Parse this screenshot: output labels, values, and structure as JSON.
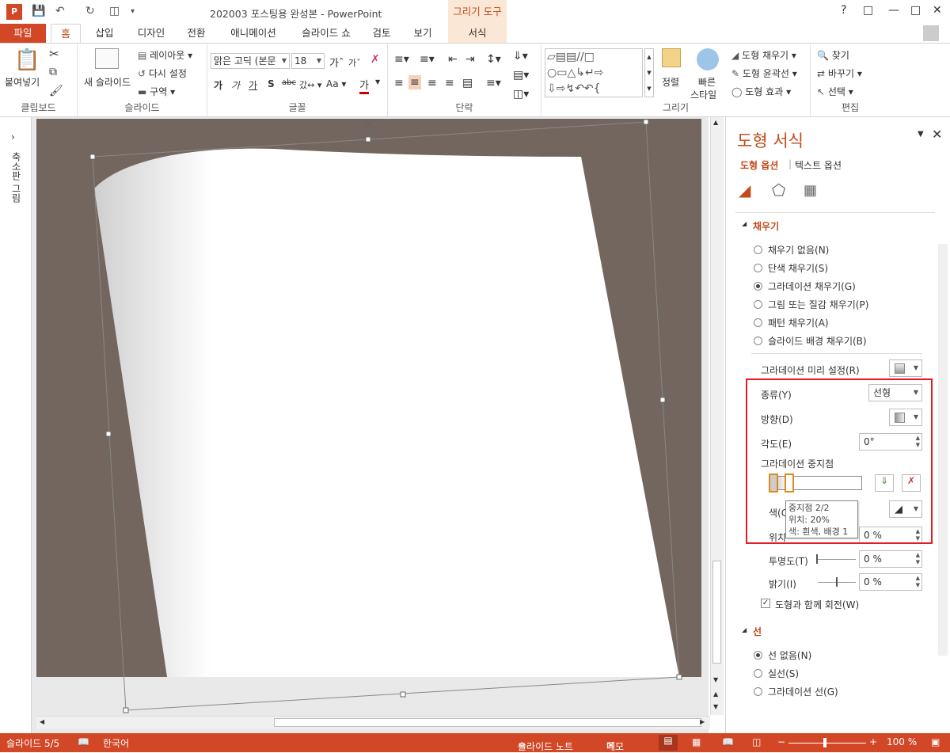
{
  "titlebar": {
    "title": "202003 포스팅용 완성본 - PowerPoint",
    "drawing_tools": "그리기 도구"
  },
  "tabs": [
    "파일",
    "홈",
    "삽입",
    "디자인",
    "전환",
    "애니메이션",
    "슬라이드 쇼",
    "검토",
    "보기",
    "서식"
  ],
  "ribbon": {
    "clipboard": {
      "paste": "붙여넣기",
      "label": "클립보드"
    },
    "slides": {
      "new_slide": "새 슬라이드",
      "layout": "레이아웃",
      "reset": "다시 설정",
      "section": "구역",
      "label": "슬라이드"
    },
    "font": {
      "font_name": "맑은 고딕 (본문",
      "font_size": "18",
      "label": "글꼴"
    },
    "paragraph": {
      "label": "단락"
    },
    "drawing": {
      "arrange": "정렬",
      "quick_styles": "빠른",
      "quick_styles2": "스타일",
      "shape_fill": "도형 채우기",
      "shape_outline": "도형 윤곽선",
      "shape_effects": "도형 효과",
      "label": "그리기"
    },
    "editing": {
      "find": "찾기",
      "replace": "바꾸기",
      "select": "선택",
      "label": "편집"
    }
  },
  "sidebar": {
    "label": "축소판 그림"
  },
  "pane": {
    "title": "도형 서식",
    "tab_shape": "도형 옵션",
    "tab_text": "텍스트 옵션",
    "fill_section": "채우기",
    "fill_options": [
      "채우기 없음(N)",
      "단색 채우기(S)",
      "그라데이션 채우기(G)",
      "그림 또는 질감 채우기(P)",
      "패턴 채우기(A)",
      "슬라이드 배경 채우기(B)"
    ],
    "fill_selected": 2,
    "preset_label": "그라데이션 미리 설정(R)",
    "type_label": "종류(Y)",
    "type_value": "선형",
    "direction_label": "방향(D)",
    "angle_label": "각도(E)",
    "angle_value": "0°",
    "stops_label": "그라데이션 중지점",
    "color_label": "색(C)",
    "position_label": "위치",
    "position_value": "0 %",
    "transparency_label": "투명도(T)",
    "transparency_value": "0 %",
    "brightness_label": "밝기(I)",
    "brightness_value": "0 %",
    "rotate_label": "도형과 함께 회전(W)",
    "line_section": "선",
    "line_options": [
      "선 없음(N)",
      "실선(S)",
      "그라데이션 선(G)"
    ],
    "line_selected": 0
  },
  "tooltip": [
    "중지점 2/2",
    "위치: 20%",
    "색: 흰색, 배경 1"
  ],
  "status": {
    "slide": "슬라이드 5/5",
    "language": "한국어",
    "notes": "슬라이드 노트",
    "comments": "메모",
    "zoom": "100 %"
  },
  "colors": {
    "accent": "#d24726",
    "slide_bg": "#73665e",
    "highlight": "#e41b23"
  }
}
